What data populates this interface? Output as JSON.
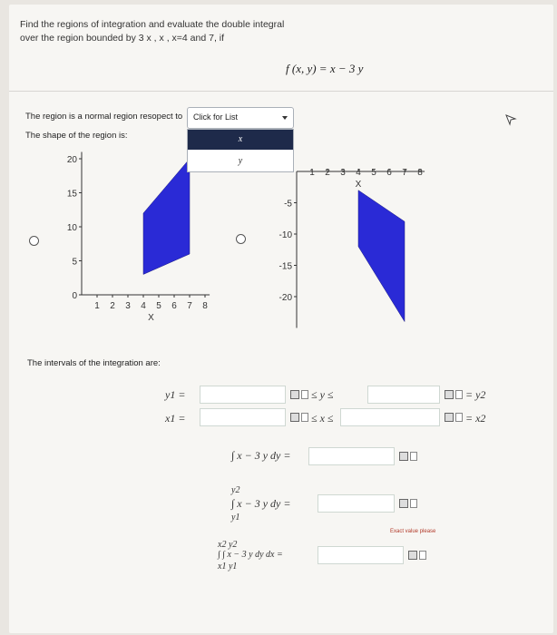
{
  "problem": {
    "line1": "Find the regions of integration and evaluate the double integral",
    "line2": "over the region bounded by 3 x , x , x=4 and  7, if",
    "function": "f (x, y) = x − 3 y"
  },
  "region": {
    "normal_label": "The region is a normal region resopect to",
    "dropdown_value": "Click for List",
    "dropdown_options": [
      "x",
      "y"
    ],
    "shape_label": "The shape of the region is:"
  },
  "graph1": {
    "y_ticks": [
      "20",
      "15",
      "10",
      "5",
      "0"
    ],
    "x_ticks": [
      "1",
      "2",
      "3",
      "4",
      "5",
      "6",
      "7",
      "8"
    ],
    "x_label": "X",
    "polygon": [
      [
        4,
        3
      ],
      [
        7,
        6
      ],
      [
        7,
        20
      ],
      [
        4,
        12
      ]
    ]
  },
  "graph2": {
    "y_ticks": [
      "-5",
      "-10",
      "-15",
      "-20"
    ],
    "x_ticks": [
      "1",
      "2",
      "3",
      "4",
      "5",
      "6",
      "7",
      "8"
    ],
    "x_label": "X",
    "polygon": [
      [
        4,
        -3
      ],
      [
        7,
        -8
      ],
      [
        7,
        -24
      ],
      [
        4,
        -12
      ]
    ]
  },
  "intervals": {
    "label": "The intervals of the integration are:",
    "y1": "y1 =",
    "x1": "x1 =",
    "y_ineq": "≤ y ≤",
    "x_ineq": "≤ x ≤",
    "y2": "= y2",
    "x2": "= x2"
  },
  "integrals": {
    "inner": "∫ x − 3 y dy =",
    "definite_top": "y2",
    "definite_body": "∫ x − 3 y dy =",
    "definite_bottom": "y1",
    "exact_note": "Exact value please",
    "double_top": "x2 y2",
    "double_body": "∫ ∫ x − 3 y dy dx =",
    "double_bottom": "x1 y1"
  },
  "colors": {
    "region_fill": "#2a2ad6",
    "accent": "#1e2a4a"
  }
}
